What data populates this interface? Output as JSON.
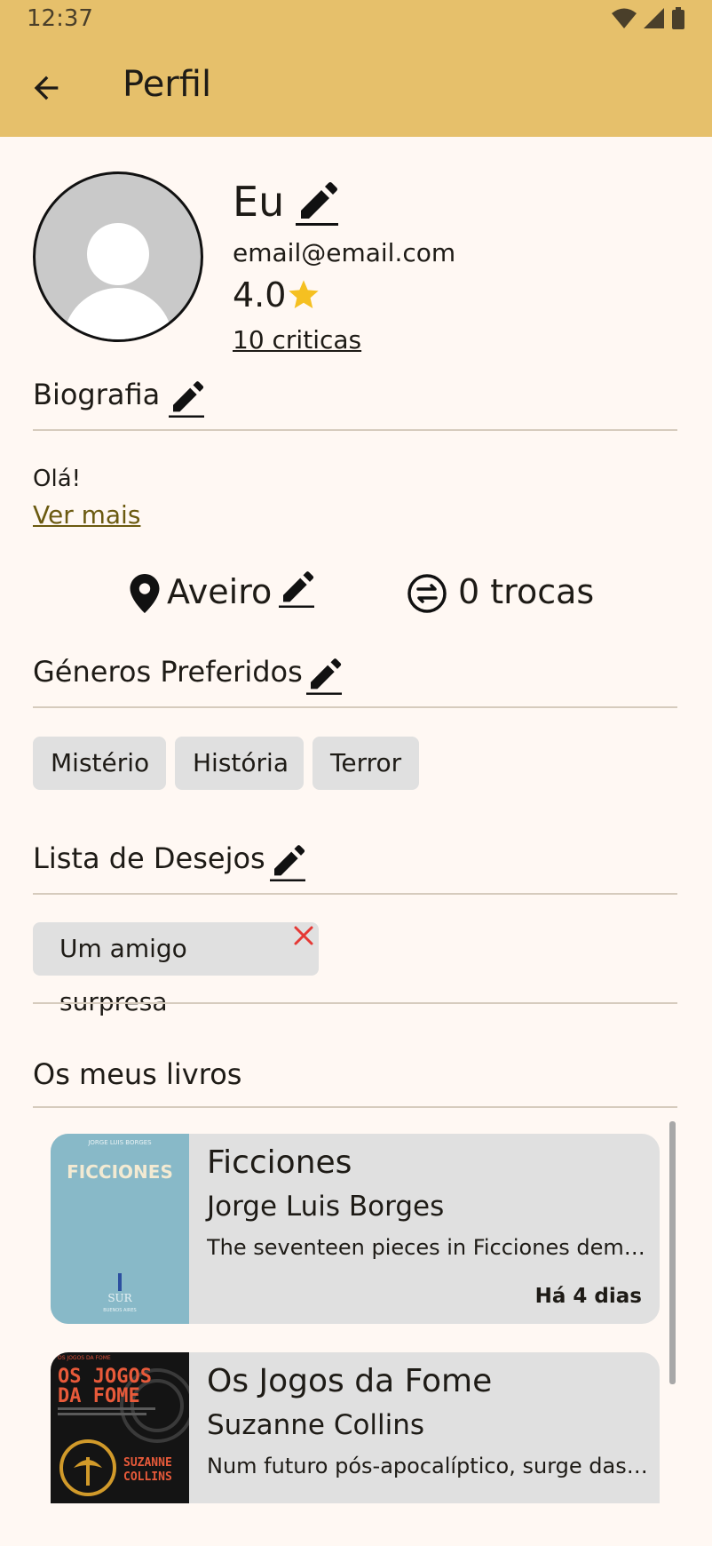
{
  "status_bar": {
    "time": "12:37"
  },
  "app_bar": {
    "title": "Perfil"
  },
  "profile": {
    "name": "Eu",
    "email": "email@email.com",
    "rating": "4.0",
    "reviews_link": "10 criticas"
  },
  "bio": {
    "heading": "Biografia",
    "text": "Olá!",
    "see_more": "Ver mais"
  },
  "location": {
    "city": "Aveiro",
    "trades": "0 trocas"
  },
  "genres": {
    "heading": "Géneros Preferidos",
    "items": [
      "Mistério",
      "História",
      "Terror"
    ]
  },
  "wishlist": {
    "heading": "Lista de Desejos",
    "items": [
      "Um amigo surpresa"
    ]
  },
  "my_books": {
    "heading": "Os meus livros",
    "items": [
      {
        "title": "Ficciones",
        "author": "Jorge Luis Borges",
        "description": "The seventeen pieces in Ficciones demonstrate the range of Borges' genius",
        "date": "Há 4 dias",
        "cover": {
          "top_text": "JORGE LUIS BORGES",
          "title": "FICCIONES",
          "publisher": "SUR",
          "city": "BUENOS AIRES"
        }
      },
      {
        "title": "Os Jogos da Fome",
        "author": "Suzanne Collins",
        "description": "Num futuro pós-apocalíptico, surge das cinzas do que foi a América",
        "cover": {
          "top_text": "OS JOGOS DA FOME",
          "title_line1": "OS JOGOS",
          "title_line2": "DA FOME",
          "author_line1": "SUZANNE",
          "author_line2": "COLLINS"
        }
      }
    ]
  },
  "colors": {
    "app_bar": "#e6c06b",
    "background": "#fff8f3",
    "chip": "#e0e0e0",
    "star": "#f5c021",
    "link": "#6b5a10",
    "remove": "#e53935"
  }
}
